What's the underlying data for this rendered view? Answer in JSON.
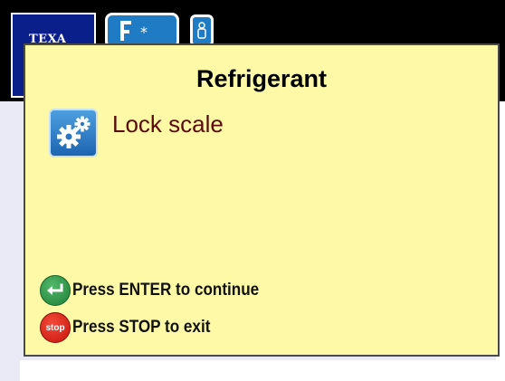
{
  "background": {
    "brand_logo_text": "TEXA",
    "app_icons": [
      "fridge-icon",
      "person-icon"
    ]
  },
  "dialog": {
    "title": "Refrigerant",
    "option": {
      "icon": "gears-icon",
      "label": "Lock scale"
    },
    "hints": {
      "enter": {
        "icon": "enter-arrow-icon",
        "text": "Press ENTER to continue"
      },
      "stop": {
        "icon": "stop-icon",
        "icon_text": "stop",
        "text": "Press STOP to exit"
      }
    }
  },
  "colors": {
    "dialog_background": "#fdf9a6",
    "option_label": "#5a0a0a",
    "enter_green": "#1e7f36",
    "stop_red": "#c8140c",
    "logo_blue": "#0a1f8a"
  }
}
